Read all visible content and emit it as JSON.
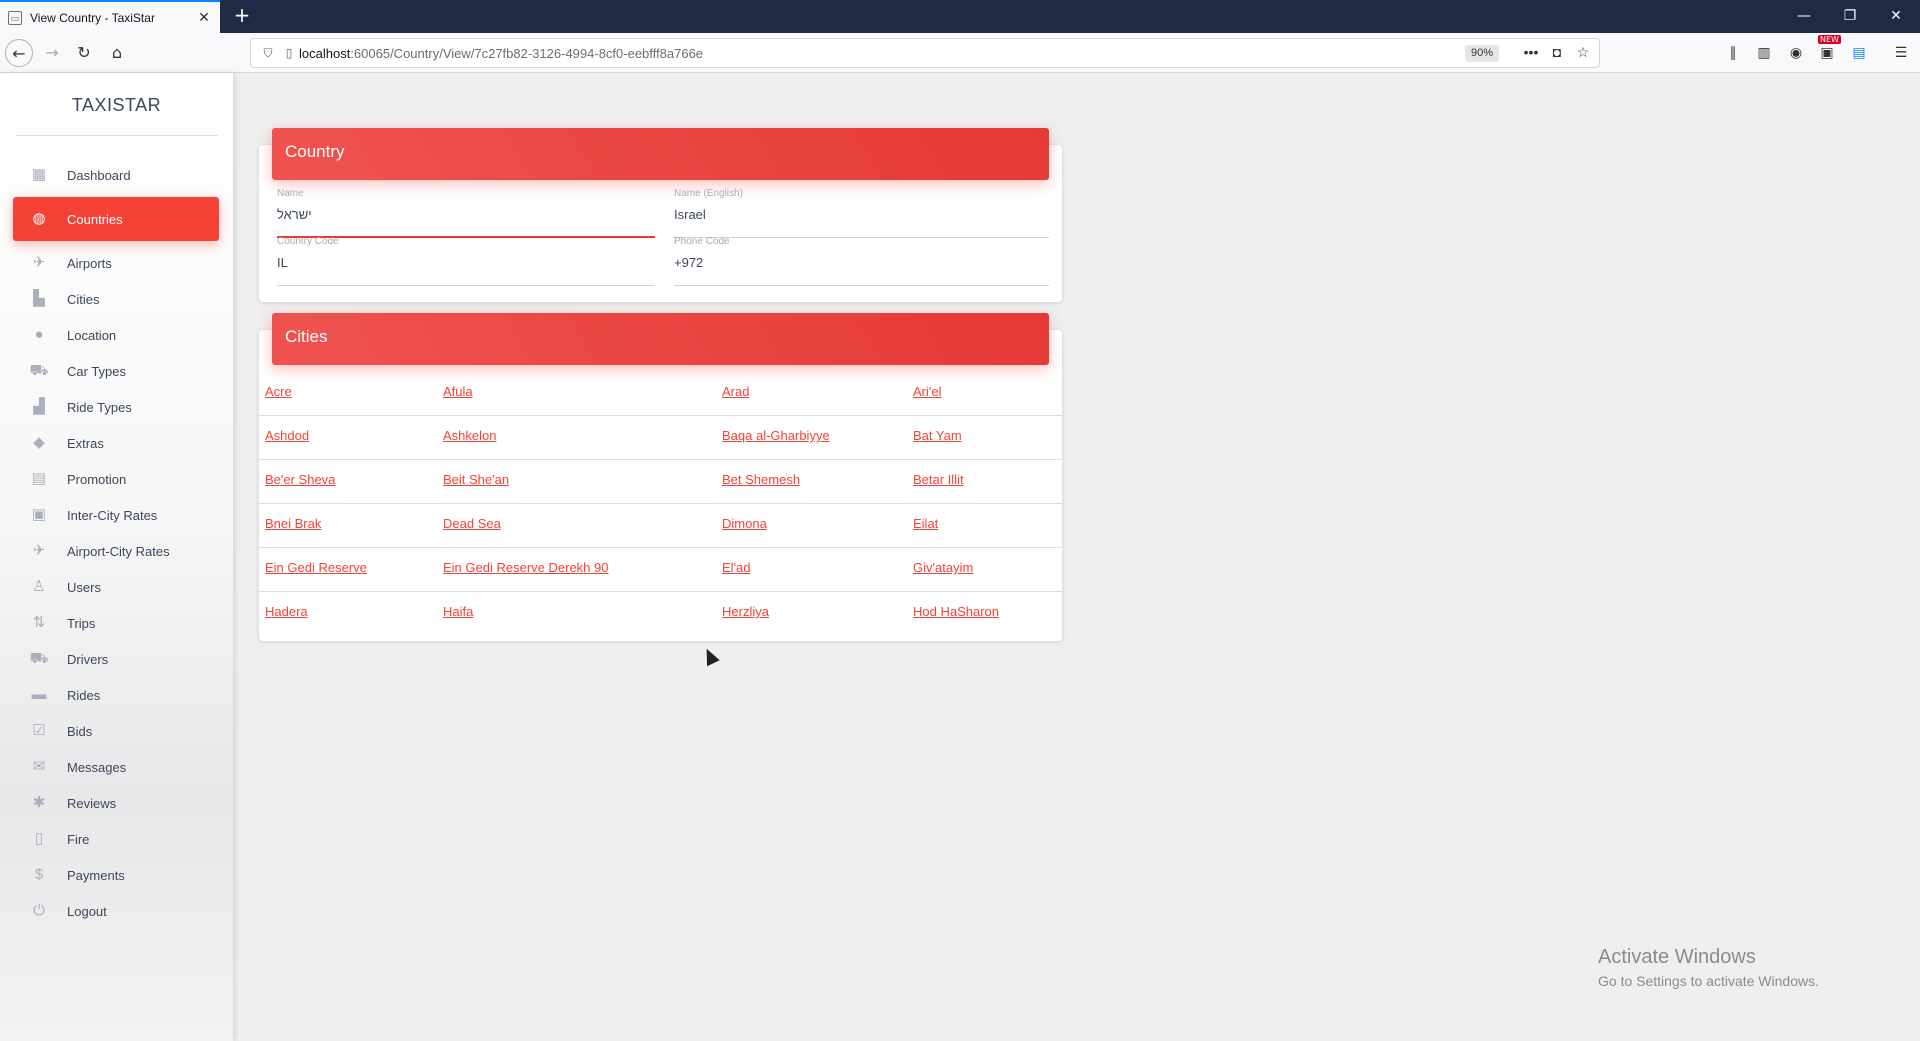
{
  "browser": {
    "tab_title": "View Country - TaxiStar",
    "tab_favicon": "document-icon",
    "new_tab": "+",
    "url_host": "localhost",
    "url_rest": ":60065/Country/View/7c27fb82-3126-4994-8cf0-eebfff8a766e",
    "zoom": "90%",
    "new_badge": "NEW"
  },
  "sidebar": {
    "brand": "TAXISTAR",
    "items": [
      {
        "label": "Dashboard",
        "icon": "dashboard-icon",
        "glyph": "▦"
      },
      {
        "label": "Countries",
        "icon": "globe-icon",
        "glyph": "◍",
        "active": true
      },
      {
        "label": "Airports",
        "icon": "airplane-icon",
        "glyph": "✈"
      },
      {
        "label": "Cities",
        "icon": "city-icon",
        "glyph": "▙"
      },
      {
        "label": "Location",
        "icon": "location-pin-icon",
        "glyph": "●"
      },
      {
        "label": "Car Types",
        "icon": "car-icon",
        "glyph": "⛟"
      },
      {
        "label": "Ride Types",
        "icon": "seat-icon",
        "glyph": "▟"
      },
      {
        "label": "Extras",
        "icon": "extras-icon",
        "glyph": "◆"
      },
      {
        "label": "Promotion",
        "icon": "promotion-icon",
        "glyph": "▤"
      },
      {
        "label": "Inter-City Rates",
        "icon": "rates-icon",
        "glyph": "▣"
      },
      {
        "label": "Airport-City Rates",
        "icon": "airplane-departure-icon",
        "glyph": "✈"
      },
      {
        "label": "Users",
        "icon": "user-icon",
        "glyph": "♙"
      },
      {
        "label": "Trips",
        "icon": "trips-icon",
        "glyph": "⇅"
      },
      {
        "label": "Drivers",
        "icon": "driver-car-icon",
        "glyph": "⛟"
      },
      {
        "label": "Rides",
        "icon": "bus-icon",
        "glyph": "▬"
      },
      {
        "label": "Bids",
        "icon": "checkbox-icon",
        "glyph": "☑"
      },
      {
        "label": "Messages",
        "icon": "message-icon",
        "glyph": "✉"
      },
      {
        "label": "Reviews",
        "icon": "reviews-icon",
        "glyph": "✱"
      },
      {
        "label": "Fire",
        "icon": "clipboard-icon",
        "glyph": "▯"
      },
      {
        "label": "Payments",
        "icon": "dollar-icon",
        "glyph": "$"
      },
      {
        "label": "Logout",
        "icon": "plug-icon",
        "glyph": "⏻"
      }
    ]
  },
  "country": {
    "title": "Country",
    "name_label": "Name",
    "name_value": "ישראל",
    "name_en_label": "Name (English)",
    "name_en_value": "Israel",
    "code_label": "Country Code",
    "code_value": "IL",
    "phone_label": "Phone Code",
    "phone_value": "+972"
  },
  "cities": {
    "title": "Cities",
    "rows": [
      [
        "Acre",
        "Afula",
        "Arad",
        "Ari'el"
      ],
      [
        "Ashdod",
        "Ashkelon",
        "Baqa al-Gharbiyye",
        "Bat Yam"
      ],
      [
        "Be'er Sheva",
        "Beit She'an",
        "Bet Shemesh",
        "Betar Illit"
      ],
      [
        "Bnei Brak",
        "Dead Sea",
        "Dimona",
        "Eilat"
      ],
      [
        "Ein Gedi Reserve",
        "Ein Gedi Reserve Derekh 90",
        "El'ad",
        "Giv'atayim"
      ],
      [
        "Hadera",
        "Haifa",
        "Herzliya",
        "Hod HaSharon"
      ]
    ]
  },
  "watermark": {
    "line1": "Activate Windows",
    "line2": "Go to Settings to activate Windows."
  }
}
